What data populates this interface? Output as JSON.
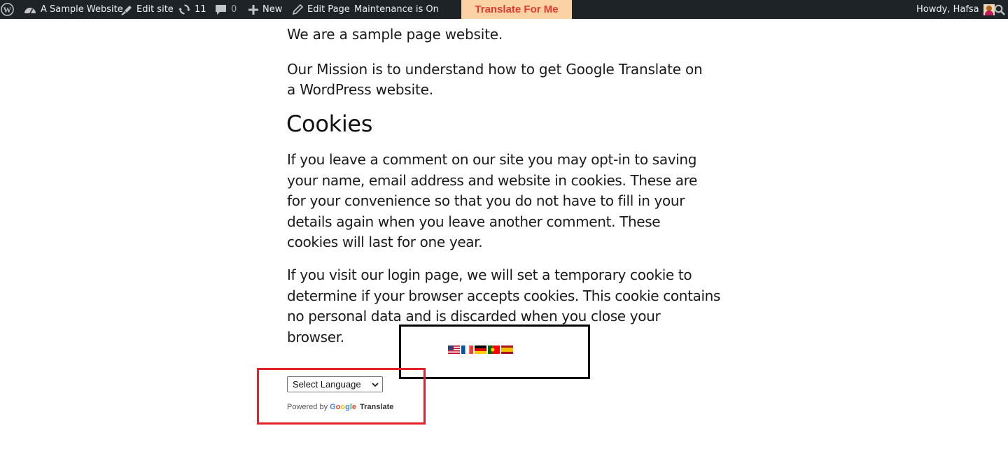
{
  "adminbar": {
    "site_name": "A Sample Website",
    "edit_site": "Edit site",
    "updates_count": "11",
    "comments_count": "0",
    "new_label": "New",
    "edit_page": "Edit Page",
    "maintenance": "Maintenance is On",
    "translate_button": "Translate For Me",
    "howdy": "Howdy, Hafsa",
    "icons": [
      "wordpress-icon",
      "dashboard-icon",
      "brush-icon",
      "updates-icon",
      "comment-icon",
      "plus-icon",
      "pencil-icon",
      "avatar",
      "search-icon"
    ],
    "bg_color": "#1d2327",
    "translate_bg": "#fbd2a3",
    "translate_color": "#e13a2e"
  },
  "content": {
    "intro": "We are a sample page website.",
    "mission": "Our Mission is to understand how to get Google Translate on a WordPress website.",
    "cookies_heading": "Cookies",
    "cookies_p1": "If you leave a comment on our site you may opt-in to saving your name, email address and website in cookies. These are for your convenience so that you do not have to fill in your details again when you leave another comment. These cookies will last for one year.",
    "cookies_p2": "If you visit our login page, we will set a temporary cookie to determine if your browser accepts cookies. This cookie contains no personal data and is discarded when you close your browser."
  },
  "translate_widget": {
    "flags": [
      "us-flag",
      "france-flag",
      "germany-flag",
      "portugal-flag",
      "spain-flag"
    ],
    "select_value": "Select Language",
    "powered_by": "Powered by",
    "google": "Google",
    "translate": "Translate"
  },
  "annotations": {
    "black_box_color": "#000000",
    "red_box_color": "#e4202a"
  }
}
